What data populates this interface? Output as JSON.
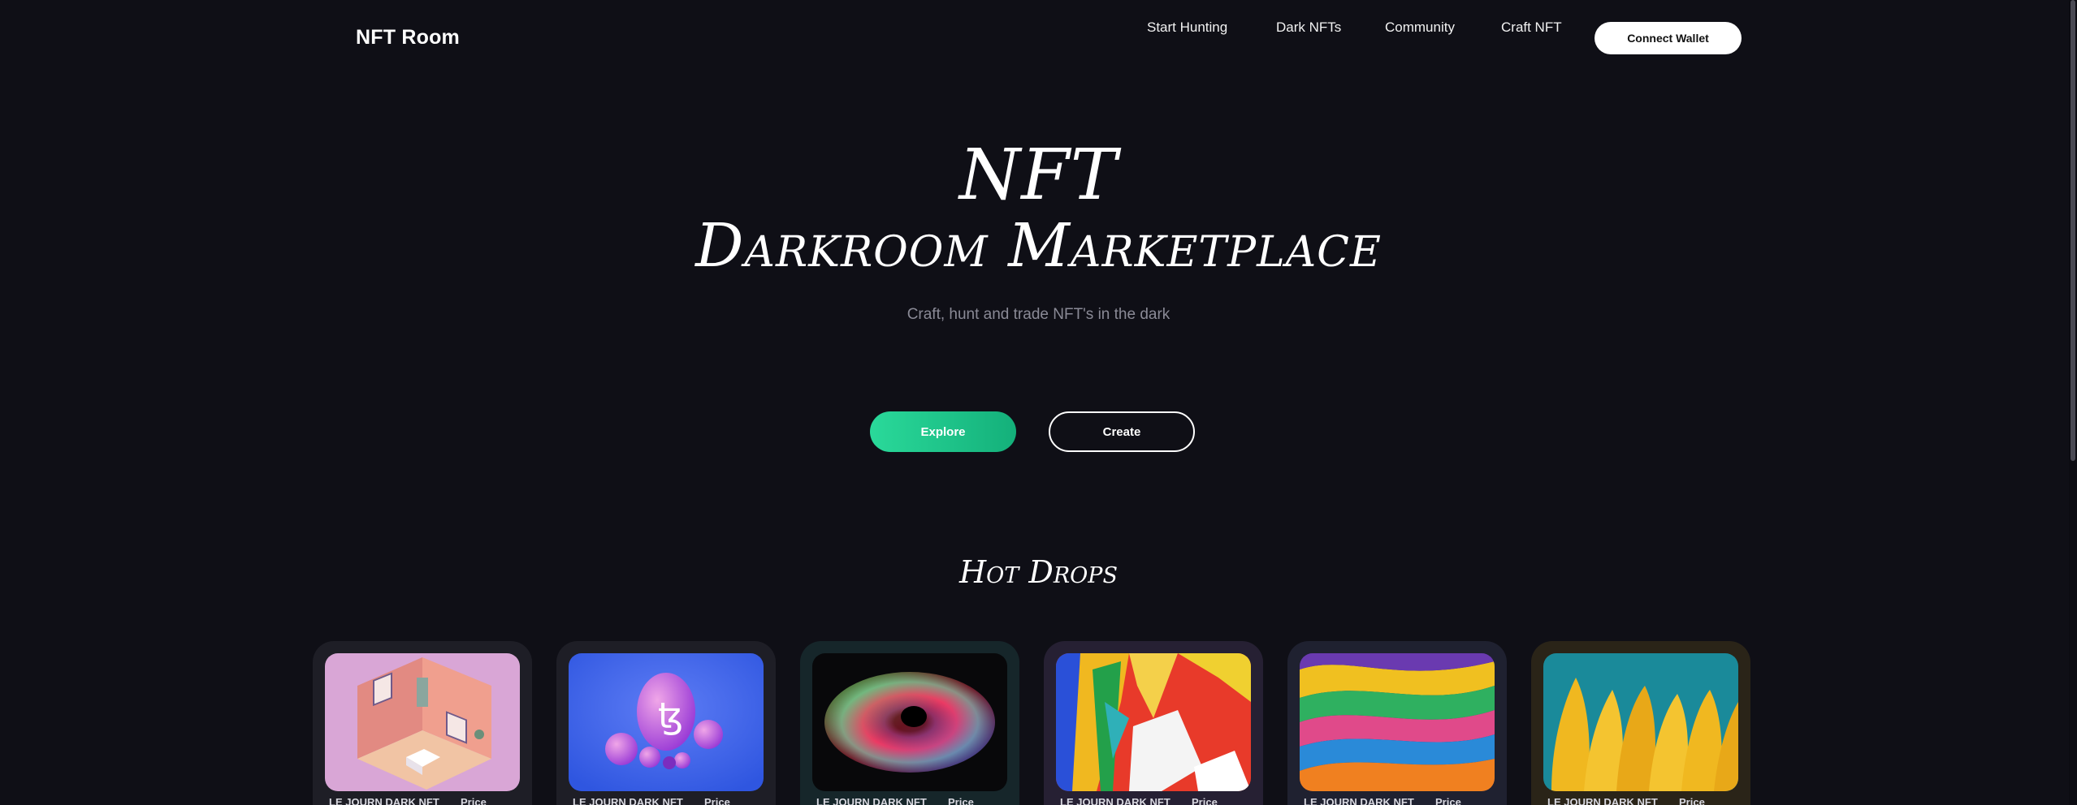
{
  "nav": {
    "logo": "NFT Room",
    "links": [
      "Start Hunting",
      "Dark NFTs",
      "Community",
      "Craft NFT"
    ],
    "connect_label": "Connect Wallet"
  },
  "hero": {
    "title_line1": "NFT",
    "title_line2": "Darkroom Marketplace",
    "subtitle": "Craft, hunt and trade NFT's in the dark",
    "explore_label": "Explore",
    "create_label": "Create"
  },
  "hot_drops": {
    "title": "Hot Drops",
    "cards": [
      {
        "name": "LE JOURN DARK NFT",
        "price_label": "Price",
        "art": "isometric-room"
      },
      {
        "name": "LE JOURN DARK NFT",
        "price_label": "Price",
        "art": "tezos-spheres"
      },
      {
        "name": "LE JOURN DARK NFT",
        "price_label": "Price",
        "art": "rgb-ring"
      },
      {
        "name": "LE JOURN DARK NFT",
        "price_label": "Price",
        "art": "paint-splash"
      },
      {
        "name": "LE JOURN DARK NFT",
        "price_label": "Price",
        "art": "marble-swirl"
      },
      {
        "name": "LE JOURN DARK NFT",
        "price_label": "Price",
        "art": "yellow-drips"
      }
    ]
  },
  "colors": {
    "background": "#0f0f16",
    "accent_green": "#1fc98a",
    "card_bg": "#1e1e26"
  }
}
